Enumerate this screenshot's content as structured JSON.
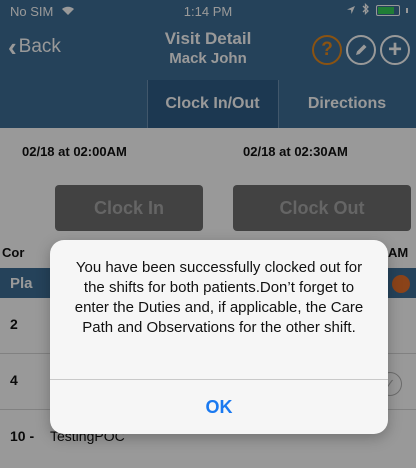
{
  "status_bar": {
    "carrier": "No SIM",
    "time": "1:14 PM"
  },
  "nav": {
    "back_label": "Back",
    "title": "Visit Detail",
    "subtitle": "Mack John",
    "help_glyph": "?",
    "add_glyph": "+"
  },
  "tabs": {
    "clock": "Clock In/Out",
    "directions": "Directions"
  },
  "clock": {
    "in_time": "02/18 at 02:00AM",
    "out_time": "02/18 at 02:30AM",
    "in_label": "Clock In",
    "out_label": "Clock Out"
  },
  "background_fragments": {
    "left_cut": "Cor",
    "right_cut": "AM",
    "section_cut": "Pla",
    "row2_num": "2",
    "row4_num": "4"
  },
  "list": {
    "last_row_num": "10 -",
    "last_row_text": "TestingPOC"
  },
  "alert": {
    "message": "You have been successfully clocked out for the shifts for both patients.Don’t forget to enter the Duties and, if applicable, the Care Path and Observations for the other shift.",
    "ok_label": "OK"
  },
  "colors": {
    "nav_blue": "#3e6f97",
    "active_tab": "#2f5e87",
    "help_orange": "#e68a1f",
    "ios_blue": "#1a79f0"
  },
  "icons": {
    "wifi": "wifi-icon",
    "battery": "battery-icon",
    "back": "chevron-left-icon",
    "help": "help-icon",
    "edit": "pencil-icon",
    "add": "plus-icon"
  }
}
